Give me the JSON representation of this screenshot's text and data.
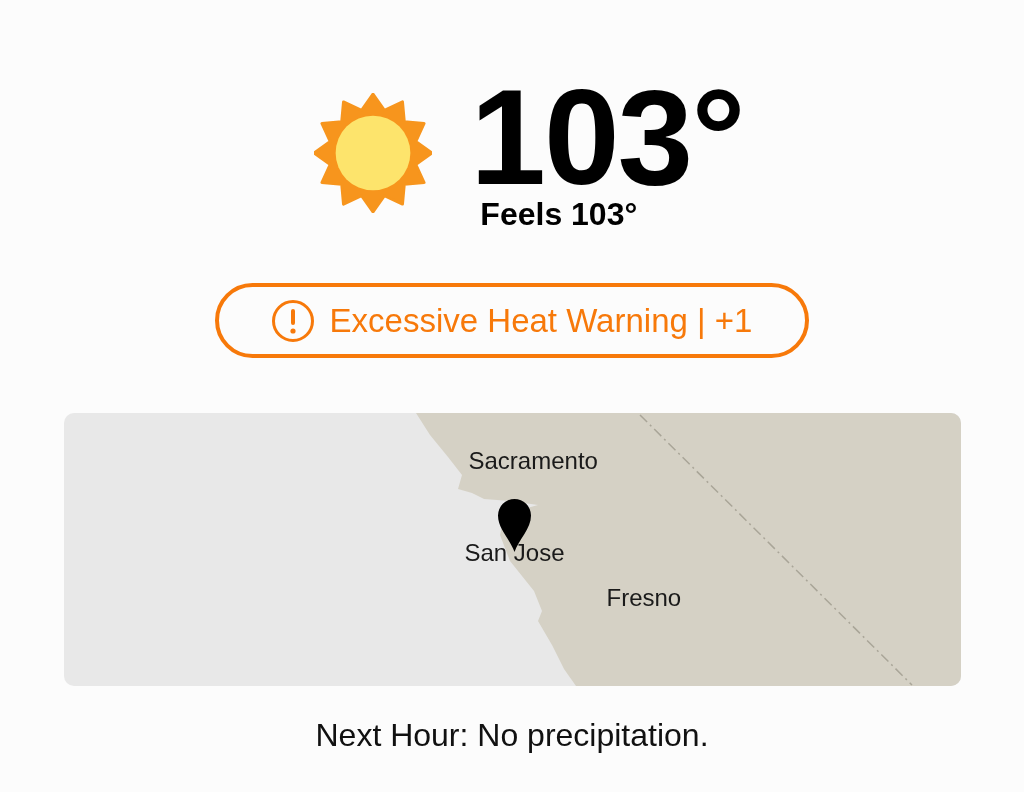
{
  "current": {
    "temperature": "103°",
    "feels_like": "Feels 103°"
  },
  "alert": {
    "label": "Excessive Heat Warning | +1"
  },
  "map": {
    "labels": [
      {
        "text": "Sacramento"
      },
      {
        "text": "San Jose"
      },
      {
        "text": "Fresno"
      }
    ]
  },
  "next_hour": "Next Hour: No precipitation."
}
